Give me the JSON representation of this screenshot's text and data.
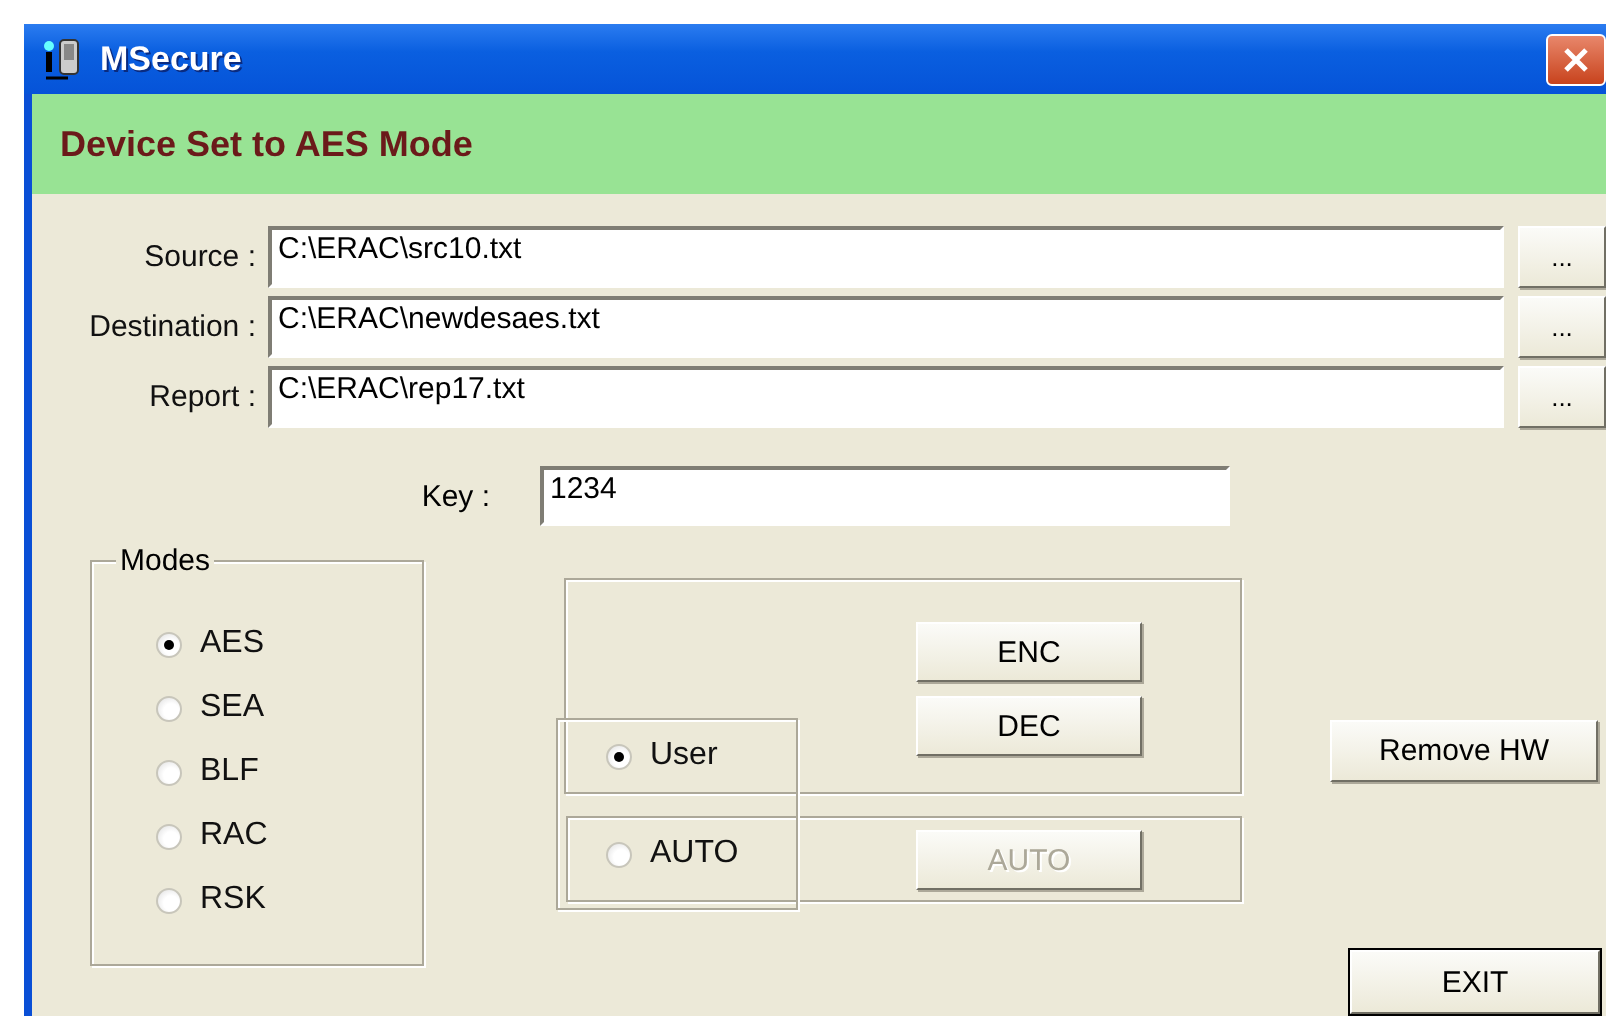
{
  "window": {
    "title": "MSecure"
  },
  "banner": "Device Set to AES Mode",
  "paths": [
    {
      "label": "Source :",
      "value": "C:\\ERAC\\src10.txt",
      "browse": "..."
    },
    {
      "label": "Destination :",
      "value": "C:\\ERAC\\newdesaes.txt",
      "browse": "..."
    },
    {
      "label": "Report :",
      "value": "C:\\ERAC\\rep17.txt",
      "browse": "..."
    }
  ],
  "key": {
    "label": "Key :",
    "value": "1234"
  },
  "modes": {
    "title": "Modes",
    "options": [
      {
        "label": "AES",
        "selected": true
      },
      {
        "label": "SEA",
        "selected": false
      },
      {
        "label": "BLF",
        "selected": false
      },
      {
        "label": "RAC",
        "selected": false
      },
      {
        "label": "RSK",
        "selected": false
      }
    ]
  },
  "actions": [
    {
      "label": "ENC",
      "disabled": false
    },
    {
      "label": "DEC",
      "disabled": false
    }
  ],
  "run_modes": [
    {
      "label": "User",
      "selected": true
    },
    {
      "label": "AUTO",
      "selected": false
    }
  ],
  "auto_button": {
    "label": "AUTO",
    "disabled": true
  },
  "remove_button": "Remove HW",
  "exit_button": "EXIT"
}
